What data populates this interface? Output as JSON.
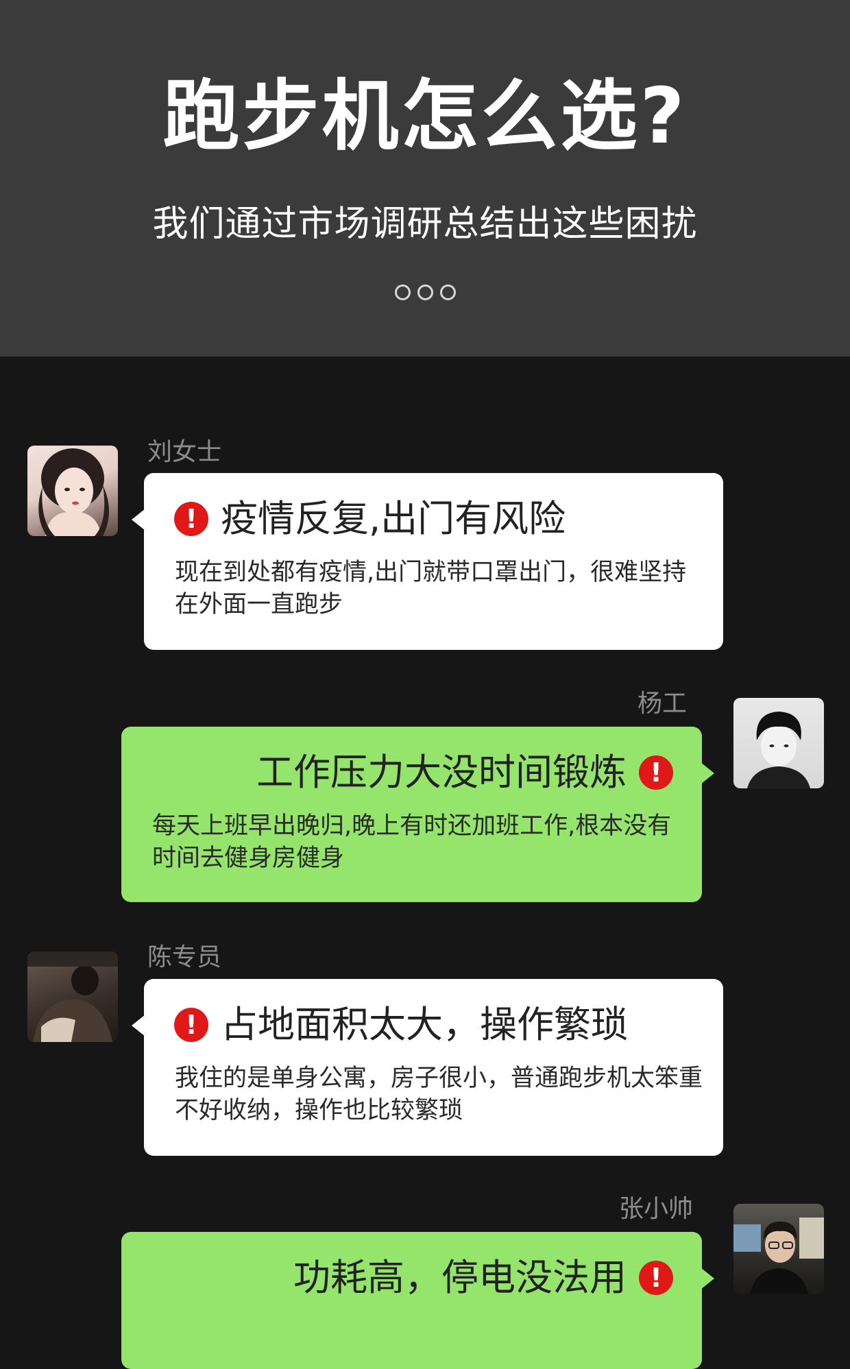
{
  "header": {
    "title": "跑步机怎么选?",
    "subtitle": "我们通过市场调研总结出这些困扰"
  },
  "messages": [
    {
      "name": "刘女士",
      "title": "疫情反复,出门有风险",
      "body": "现在到处都有疫情,出门就带口罩出门，很难坚持在外面一直跑步",
      "side": "left",
      "bubble_color": "#ffffff"
    },
    {
      "name": "杨工",
      "title": "工作压力大没时间锻炼",
      "body": "每天上班早出晚归,晚上有时还加班工作,根本没有时间去健身房健身",
      "side": "right",
      "bubble_color": "#95e46b"
    },
    {
      "name": "陈专员",
      "title": "占地面积太大，操作繁琐",
      "body": "我住的是单身公寓，房子很小，普通跑步机太笨重不好收纳，操作也比较繁琐",
      "side": "left",
      "bubble_color": "#ffffff"
    },
    {
      "name": "张小帅",
      "title": "功耗高，停电没法用",
      "body": "",
      "side": "right",
      "bubble_color": "#95e46b"
    }
  ],
  "colors": {
    "header_bg": "#3b3b3b",
    "chat_bg": "#161616",
    "alert_red": "#e01818"
  },
  "icons": {
    "alert": "exclamation-circle-icon"
  }
}
